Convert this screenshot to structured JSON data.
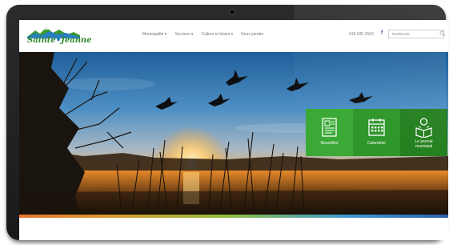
{
  "site": {
    "logo_text_a": "Sainte",
    "logo_text_dot": "•",
    "logo_text_b": "Jeanne"
  },
  "nav": {
    "items": [
      "Municipalité ▾",
      "Services ▾",
      "Culture et loisirs ▾",
      "Nous joindre"
    ]
  },
  "header": {
    "phone": "418 635-2556",
    "facebook_glyph": "f",
    "search_placeholder": "Recherche"
  },
  "tiles": [
    {
      "label": "Nouvelles",
      "icon": "newspaper-icon",
      "color": "#3aa935"
    },
    {
      "label": "Calendrier",
      "icon": "calendar-icon",
      "color": "#2e962b"
    },
    {
      "label_line1": "Le journal",
      "label_line2": "municipal",
      "icon": "reader-icon",
      "color": "#24801f"
    }
  ],
  "colors": {
    "tile_green": "#3aa935",
    "tile_green_mid": "#2e962b",
    "tile_green_dark": "#24801f",
    "stripe_start": "#e8762c",
    "stripe_end": "#2a5fae"
  }
}
